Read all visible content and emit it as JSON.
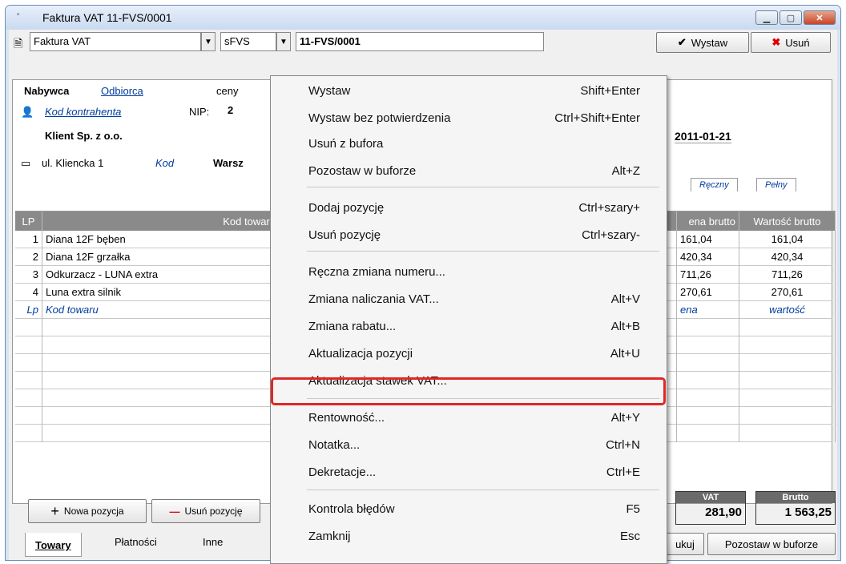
{
  "window": {
    "title": "Faktura VAT 11-FVS/0001"
  },
  "toolbar": {
    "doc_type": "Faktura VAT",
    "series": "sFVS",
    "number": "11-FVS/0001",
    "issue_label": "Wystaw",
    "delete_label": "Usuń"
  },
  "header": {
    "tab_buyer": "Nabywca",
    "tab_receiver": "Odbiorca",
    "tab_prices": "ceny",
    "contractor_code_label": "Kod kontrahenta",
    "nip_label": "NIP:",
    "nip_value": "2",
    "client_name": "Klient Sp. z o.o.",
    "address": "ul. Kliencka 1",
    "postcode_label": "Kod",
    "city": "Warsz",
    "date": "2011-01-21",
    "tab_manual": "Ręczny",
    "tab_full": "Pełny"
  },
  "grid": {
    "columns": [
      "LP",
      "Kod towaru",
      "ena brutto",
      "Wartość brutto"
    ],
    "rows": [
      {
        "lp": "1",
        "code": "Diana 12F bęben",
        "price": "161,04",
        "value": "161,04"
      },
      {
        "lp": "2",
        "code": "Diana 12F grzałka",
        "price": "420,34",
        "value": "420,34"
      },
      {
        "lp": "3",
        "code": "Odkurzacz - LUNA extra",
        "price": "711,26",
        "value": "711,26"
      },
      {
        "lp": "4",
        "code": "Luna extra silnik",
        "price": "270,61",
        "value": "270,61"
      }
    ],
    "input_row": {
      "lp": "Lp",
      "code": "Kod towaru",
      "price": "ena",
      "value": "wartość"
    }
  },
  "bottom": {
    "add_item": "Nowa pozycja",
    "remove_item": "Usuń pozycję",
    "vat_label": "VAT",
    "vat_value": "281,90",
    "gross_label": "Brutto",
    "gross_value": "1 563,25",
    "print_label": "ukuj",
    "keep_buffer": "Pozostaw w buforze",
    "tabs": [
      "Towary",
      "Płatności",
      "Inne"
    ]
  },
  "menu": {
    "items": [
      {
        "label": "Wystaw",
        "shortcut": "Shift+Enter"
      },
      {
        "label": "Wystaw bez potwierdzenia",
        "shortcut": "Ctrl+Shift+Enter"
      },
      {
        "label": "Usuń z bufora",
        "shortcut": ""
      },
      {
        "label": "Pozostaw w buforze",
        "shortcut": "Alt+Z"
      },
      {
        "label": "Dodaj pozycję",
        "shortcut": "Ctrl+szary+"
      },
      {
        "label": "Usuń pozycję",
        "shortcut": "Ctrl+szary-"
      },
      {
        "label": "Ręczna zmiana numeru...",
        "shortcut": ""
      },
      {
        "label": "Zmiana naliczania VAT...",
        "shortcut": "Alt+V"
      },
      {
        "label": "Zmiana rabatu...",
        "shortcut": "Alt+B"
      },
      {
        "label": "Aktualizacja pozycji",
        "shortcut": "Alt+U"
      },
      {
        "label": "Aktualizacja stawek VAT...",
        "shortcut": ""
      },
      {
        "label": "Rentowność...",
        "shortcut": "Alt+Y"
      },
      {
        "label": "Notatka...",
        "shortcut": "Ctrl+N"
      },
      {
        "label": "Dekretacje...",
        "shortcut": "Ctrl+E"
      },
      {
        "label": "Kontrola błędów",
        "shortcut": "F5"
      },
      {
        "label": "Zamknij",
        "shortcut": "Esc"
      }
    ]
  },
  "colors": {
    "highlight": "#e22626",
    "header_gray": "#8a8a8a",
    "link_blue": "#003c9e"
  }
}
